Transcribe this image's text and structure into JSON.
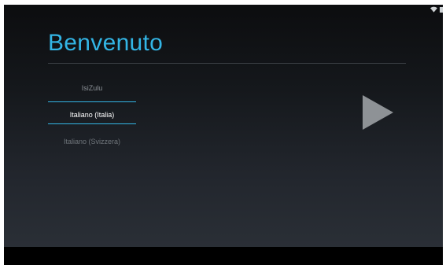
{
  "screen": {
    "title": "Benvenuto"
  },
  "languages": {
    "previous": "IsiZulu",
    "selected": "Italiano (Italia)",
    "next": "Italiano (Svizzera)"
  },
  "icons": {
    "status": [
      "wifi-icon",
      "battery-icon"
    ],
    "next": "play-arrow-icon"
  },
  "colors": {
    "accent": "#33b5e5",
    "arrow": "#8e9296",
    "background_top": "#0c0d0f",
    "background_bottom": "#2a2f36"
  }
}
